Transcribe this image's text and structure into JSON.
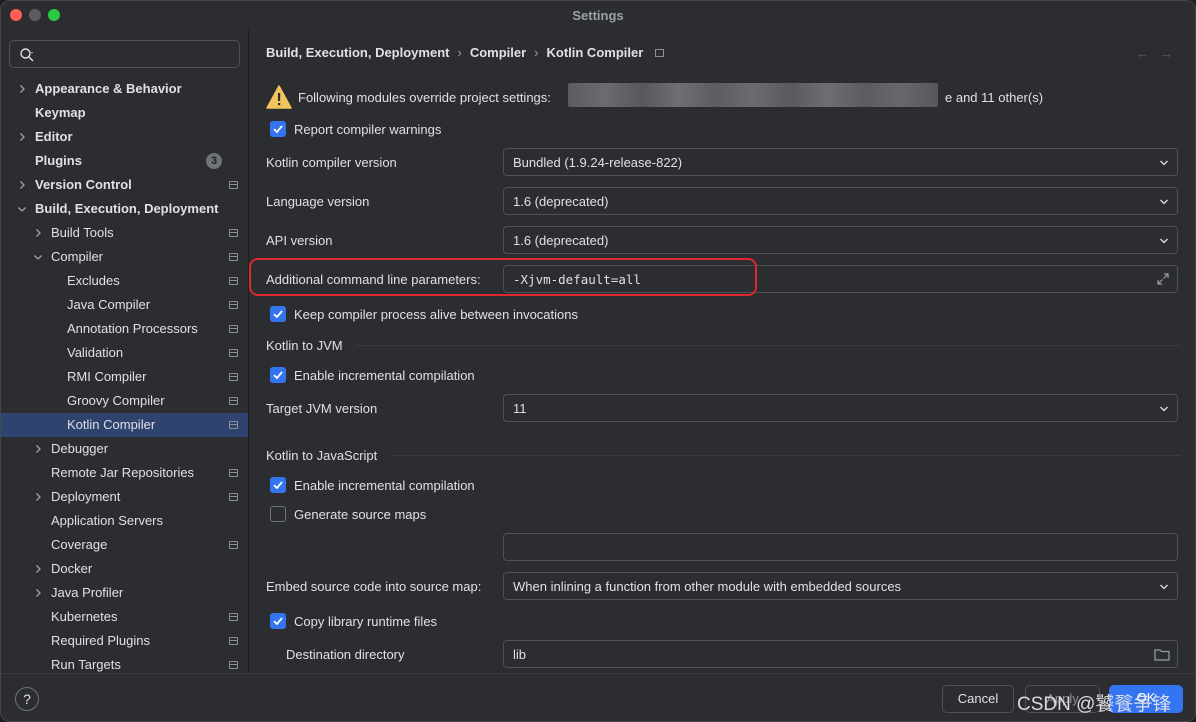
{
  "window": {
    "title": "Settings"
  },
  "search": {
    "placeholder": ""
  },
  "sidebar": {
    "items": [
      {
        "label": "Appearance & Behavior",
        "level": 0,
        "bold": true,
        "chevron": "right"
      },
      {
        "label": "Keymap",
        "level": 0,
        "bold": true,
        "chevron": "none"
      },
      {
        "label": "Editor",
        "level": 0,
        "bold": true,
        "chevron": "right"
      },
      {
        "label": "Plugins",
        "level": 0,
        "bold": true,
        "chevron": "none",
        "badge": "3"
      },
      {
        "label": "Version Control",
        "level": 0,
        "bold": true,
        "chevron": "right",
        "pin": true
      },
      {
        "label": "Build, Execution, Deployment",
        "level": 0,
        "bold": true,
        "chevron": "down"
      },
      {
        "label": "Build Tools",
        "level": 1,
        "chevron": "right",
        "pin": true
      },
      {
        "label": "Compiler",
        "level": 1,
        "chevron": "down",
        "pin": true
      },
      {
        "label": "Excludes",
        "level": 2,
        "pin": true
      },
      {
        "label": "Java Compiler",
        "level": 2,
        "pin": true
      },
      {
        "label": "Annotation Processors",
        "level": 2,
        "pin": true
      },
      {
        "label": "Validation",
        "level": 2,
        "pin": true
      },
      {
        "label": "RMI Compiler",
        "level": 2,
        "pin": true
      },
      {
        "label": "Groovy Compiler",
        "level": 2,
        "pin": true
      },
      {
        "label": "Kotlin Compiler",
        "level": 2,
        "pin": true,
        "selected": true
      },
      {
        "label": "Debugger",
        "level": 1,
        "chevron": "right"
      },
      {
        "label": "Remote Jar Repositories",
        "level": 1,
        "pin": true
      },
      {
        "label": "Deployment",
        "level": 1,
        "chevron": "right",
        "pin": true
      },
      {
        "label": "Application Servers",
        "level": 1
      },
      {
        "label": "Coverage",
        "level": 1,
        "pin": true
      },
      {
        "label": "Docker",
        "level": 1,
        "chevron": "right"
      },
      {
        "label": "Java Profiler",
        "level": 1,
        "chevron": "right"
      },
      {
        "label": "Kubernetes",
        "level": 1,
        "pin": true
      },
      {
        "label": "Required Plugins",
        "level": 1,
        "pin": true
      },
      {
        "label": "Run Targets",
        "level": 1,
        "pin": true
      }
    ]
  },
  "breadcrumb": [
    "Build, Execution, Deployment",
    "Compiler",
    "Kotlin Compiler"
  ],
  "warning": {
    "prefix": "Following modules override project settings:",
    "suffix": "e and 11 other(s)"
  },
  "form": {
    "report_warnings": "Report compiler warnings",
    "compiler_version_label": "Kotlin compiler version",
    "compiler_version_value": "Bundled (1.9.24-release-822)",
    "language_version_label": "Language version",
    "language_version_value": "1.6 (deprecated)",
    "api_version_label": "API version",
    "api_version_value": "1.6 (deprecated)",
    "cmdline_label": "Additional command line parameters:",
    "cmdline_value": "-Xjvm-default=all",
    "keep_alive": "Keep compiler process alive between invocations",
    "section_jvm": "Kotlin to JVM",
    "jvm_incremental": "Enable incremental compilation",
    "target_jvm_label": "Target JVM version",
    "target_jvm_value": "11",
    "section_js": "Kotlin to JavaScript",
    "js_incremental": "Enable incremental compilation",
    "source_maps": "Generate source maps",
    "source_map_prefix_value": "",
    "embed_label": "Embed source code into source map:",
    "embed_value": "When inlining a function from other module with embedded sources",
    "copy_runtime": "Copy library runtime files",
    "dest_label": "Destination directory",
    "dest_value": "lib"
  },
  "footer": {
    "help": "?",
    "cancel": "Cancel",
    "apply": "Apply",
    "ok": "OK"
  },
  "watermark": "CSDN @饕餮争锋",
  "colors": {
    "accent": "#3574f0",
    "highlight": "#e0262e",
    "background": "#2b2d30",
    "selected": "#2e436e"
  }
}
